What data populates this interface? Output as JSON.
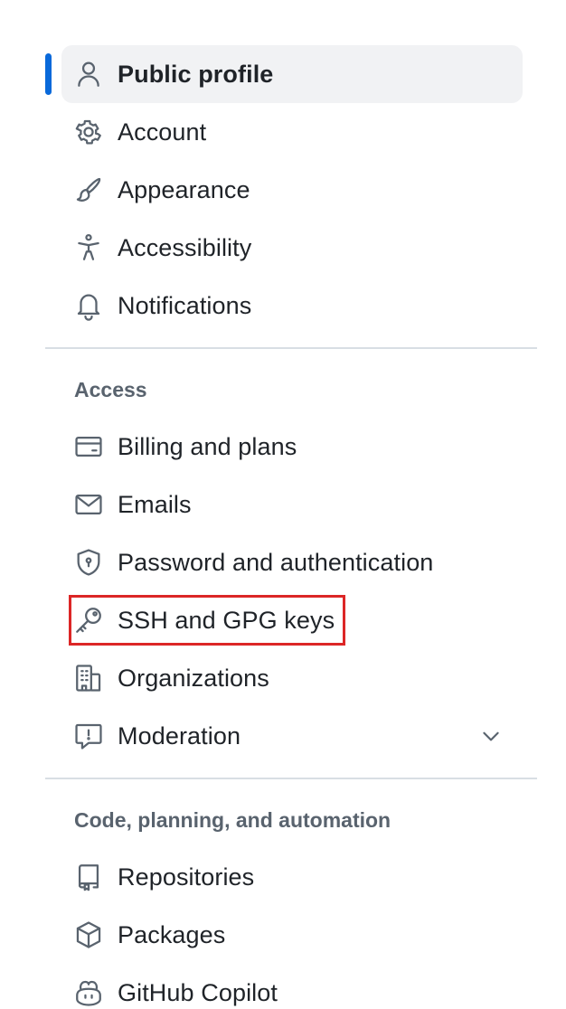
{
  "group1": {
    "items": [
      {
        "label": "Public profile",
        "icon": "person-icon",
        "active": true
      },
      {
        "label": "Account",
        "icon": "gear-icon"
      },
      {
        "label": "Appearance",
        "icon": "paintbrush-icon"
      },
      {
        "label": "Accessibility",
        "icon": "accessibility-icon"
      },
      {
        "label": "Notifications",
        "icon": "bell-icon"
      }
    ]
  },
  "access": {
    "heading": "Access",
    "items": [
      {
        "label": "Billing and plans",
        "icon": "credit-card-icon"
      },
      {
        "label": "Emails",
        "icon": "mail-icon"
      },
      {
        "label": "Password and authentication",
        "icon": "shield-lock-icon"
      },
      {
        "label": "SSH and GPG keys",
        "icon": "key-icon",
        "highlighted": true
      },
      {
        "label": "Organizations",
        "icon": "organization-icon"
      },
      {
        "label": "Moderation",
        "icon": "report-icon",
        "expandable": true
      }
    ]
  },
  "code": {
    "heading": "Code, planning, and automation",
    "items": [
      {
        "label": "Repositories",
        "icon": "repo-icon"
      },
      {
        "label": "Packages",
        "icon": "package-icon"
      },
      {
        "label": "GitHub Copilot",
        "icon": "copilot-icon"
      }
    ]
  },
  "colors": {
    "accent": "#0969da",
    "highlight": "#dc2626",
    "muted_text": "#59636e"
  }
}
